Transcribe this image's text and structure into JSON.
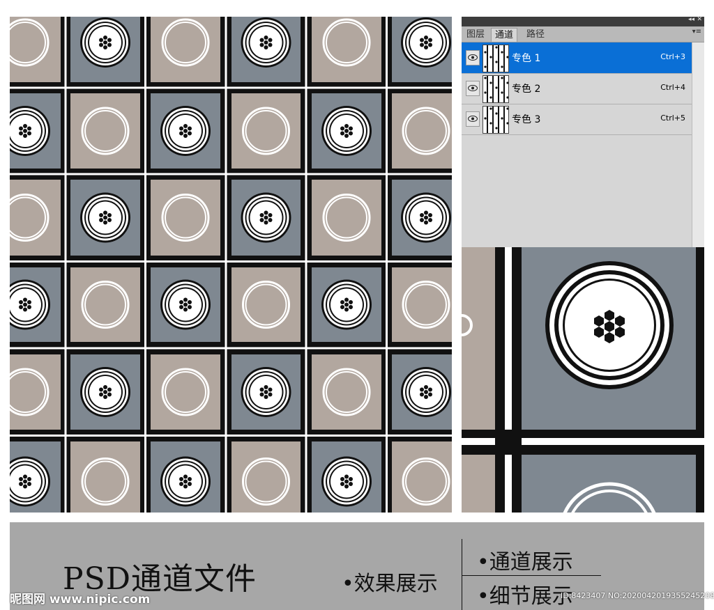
{
  "panel": {
    "tabs": [
      "图层",
      "通道",
      "路径"
    ],
    "active_tab": 1,
    "collapse_glyph": "◂◂",
    "close_glyph": "✕",
    "menu_glyph": "▾≡",
    "channels": [
      {
        "name": "专色 1",
        "shortcut": "Ctrl+3",
        "selected": true
      },
      {
        "name": "专色 2",
        "shortcut": "Ctrl+4",
        "selected": false
      },
      {
        "name": "专色 3",
        "shortcut": "Ctrl+5",
        "selected": false
      }
    ]
  },
  "caption": {
    "title": "PSD通道文件",
    "effect": "•效果展示",
    "channels": "•通道展示",
    "detail": "•细节展示"
  },
  "watermark": {
    "left": "昵图网 www.nipic.com",
    "right": "ID:8423407 NO:20200420193552452081"
  },
  "colors": {
    "tan": "#b2a79f",
    "slate": "#7f8891",
    "black": "#111111",
    "white": "#ffffff",
    "selection": "#0a6fd6",
    "panel_bg": "#d6d6d6",
    "caption_bg": "#a7a7a7"
  },
  "icons": [
    "eye-icon",
    "button-ornament-icon",
    "ring-ornament-icon"
  ]
}
